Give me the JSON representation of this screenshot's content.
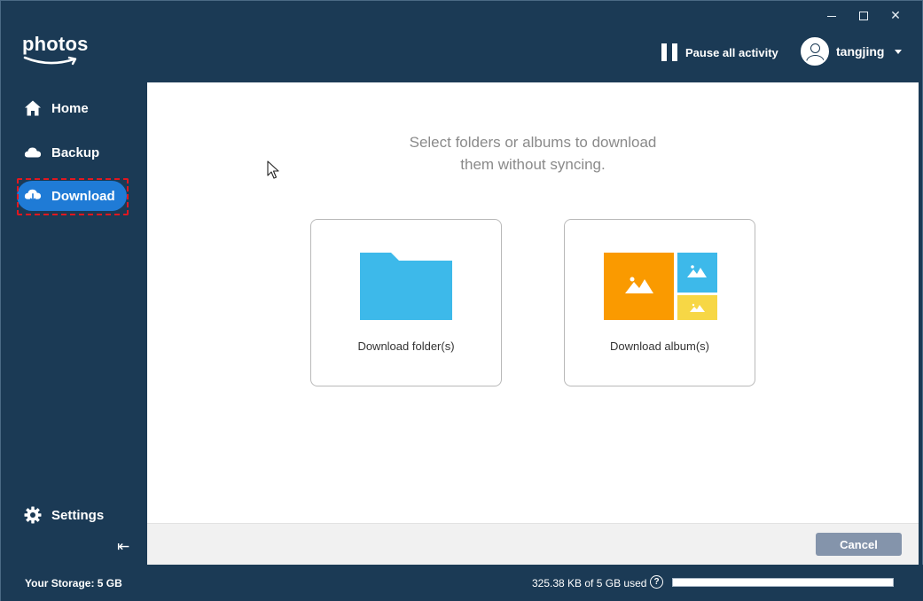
{
  "window": {
    "controls": {
      "minimize_icon": "minimize-icon",
      "maximize_icon": "maximize-icon",
      "close_glyph": "✕"
    }
  },
  "header": {
    "logo_text": "photos",
    "pause_label": "Pause all activity",
    "user_name": "tangjing"
  },
  "sidebar": {
    "items": [
      {
        "label": "Home",
        "icon": "home-icon"
      },
      {
        "label": "Backup",
        "icon": "cloud-icon"
      },
      {
        "label": "Download",
        "icon": "cloud-download-icon",
        "active": true
      },
      {
        "label": "Settings",
        "icon": "gear-icon"
      }
    ],
    "collapse_glyph": "⇤"
  },
  "main": {
    "heading_line1": "Select folders or albums to download",
    "heading_line2": "them without syncing.",
    "cards": [
      {
        "label": "Download folder(s)",
        "icon": "folder-icon"
      },
      {
        "label": "Download album(s)",
        "icon": "album-icon"
      }
    ],
    "cancel_label": "Cancel"
  },
  "status": {
    "storage_label": "Your Storage: 5 GB",
    "used_label": "325.38 KB of 5 GB used",
    "help_glyph": "?",
    "usage_fraction": 0.999
  },
  "colors": {
    "accent": "#1f7bd6",
    "background": "#1b3a55",
    "folder": "#3db9ea",
    "album_orange": "#fa9a00",
    "album_blue": "#3db9ea",
    "album_yellow": "#f7d745",
    "highlight": "#e2171f"
  }
}
